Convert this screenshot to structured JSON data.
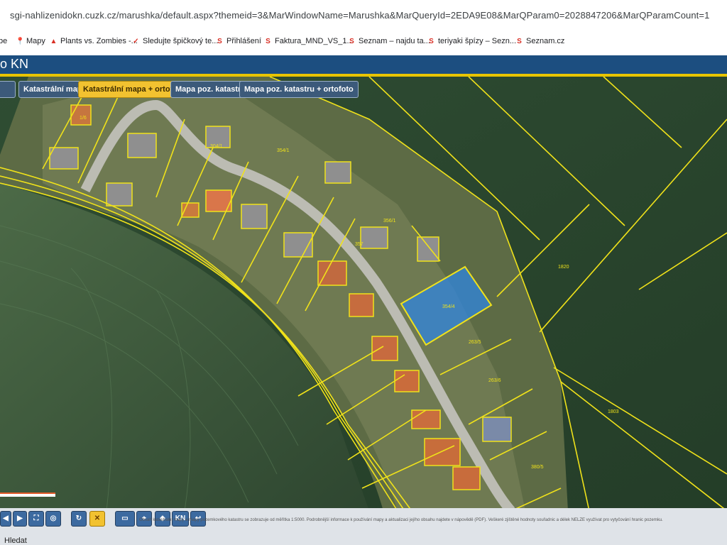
{
  "browser": {
    "url": "sgi-nahlizenidokn.cuzk.cz/marushka/default.aspx?themeid=3&MarWindowName=Marushka&MarQueryId=2EDA9E08&MarQParam0=2028847206&MarQParamCount=1",
    "bookmarks": [
      {
        "label": "be",
        "icon": "folder-icon"
      },
      {
        "label": "Mapy",
        "icon": "map-pin-icon"
      },
      {
        "label": "Plants vs. Zombies -...",
        "icon": "game-icon"
      },
      {
        "label": "Sledujte špičkový te...",
        "icon": "tv-icon"
      },
      {
        "label": "Přihlášení",
        "icon": "seznam-icon"
      },
      {
        "label": "Faktura_MND_VS_1...",
        "icon": "seznam-icon"
      },
      {
        "label": "Seznam – najdu ta...",
        "icon": "seznam-icon"
      },
      {
        "label": "teriyaki špízy – Sezn...",
        "icon": "seznam-icon"
      },
      {
        "label": "Seznam.cz",
        "icon": "seznam-icon"
      }
    ]
  },
  "app": {
    "title": "o KN",
    "layer_buttons": [
      {
        "label": "Katastrální mapa",
        "active": false
      },
      {
        "label": "Katastrální mapa + ortofoto",
        "active": true
      },
      {
        "label": "Mapa poz. katastru",
        "active": false
      },
      {
        "label": "Mapa poz. katastru + ortofoto",
        "active": false
      }
    ]
  },
  "map": {
    "parcel_labels": [
      "1/6",
      "304/1",
      "354/1",
      "357",
      "356/1",
      "354/4",
      "1820",
      "263/5",
      "263/6",
      "1803",
      "380/5"
    ],
    "colors": {
      "boundary": "#f0e21a",
      "selected_parcel": "#2f86e0",
      "road": "#b9b9b0",
      "field": "#2f4a2a"
    }
  },
  "toolbar": {
    "kn_label": "KN",
    "note": "Obsah katastrální mapy a mapy pozemkového katastru se zobrazuje od měřítka 1:5000. Podrobnější informace k používání mapy a aktualizaci jejího obsahu najdete v nápovědě (PDF). Veškeré zjištěné hodnoty souřadnic a délek NELZE využívat pro vytyčování hranic pozemku.",
    "search_label": "Hledat"
  }
}
